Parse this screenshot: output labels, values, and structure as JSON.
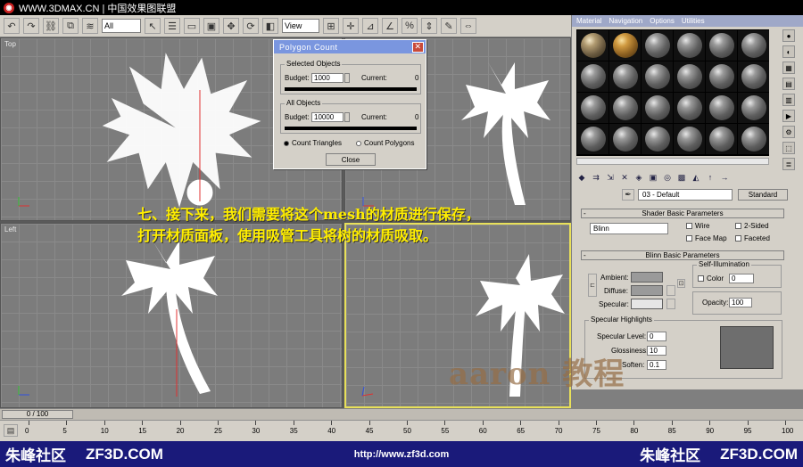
{
  "brand": {
    "text": "WWW.3DMAX.CN | 中国效果图联盟"
  },
  "toolbar": {
    "select_filter": "All",
    "ref_coord": "View"
  },
  "viewports": {
    "top_label": "Top",
    "left_label": "Left"
  },
  "polygon_dialog": {
    "title": "Polygon Count",
    "selected_group": "Selected Objects",
    "selected_budget_label": "Budget:",
    "selected_budget": "1000",
    "selected_current_label": "Current:",
    "selected_current": "0",
    "all_group": "All Objects",
    "all_budget_label": "Budget:",
    "all_budget": "10000",
    "all_current_label": "Current:",
    "all_current": "0",
    "radio_triangles": "Count Triangles",
    "radio_polygons": "Count Polygons",
    "close_label": "Close"
  },
  "material_editor": {
    "menu": [
      "Material",
      "Navigation",
      "Options",
      "Utilities"
    ],
    "material_name": "03 - Default",
    "material_type": "Standard",
    "shader_rollout": "Shader Basic Parameters",
    "shader_type": "Blinn",
    "wire": "Wire",
    "two_sided": "2-Sided",
    "face_map": "Face Map",
    "faceted": "Faceted",
    "blinn_rollout": "Blinn Basic Parameters",
    "self_illum": "Self-Illumination",
    "color_label": "Color",
    "color_value": "0",
    "ambient": "Ambient:",
    "diffuse": "Diffuse:",
    "specular": "Specular:",
    "opacity_label": "Opacity:",
    "opacity_value": "100",
    "spec_highlights": "Specular Highlights",
    "spec_level_label": "Specular Level:",
    "spec_level": "0",
    "glossiness_label": "Glossiness:",
    "glossiness": "10",
    "soften_label": "Soften:",
    "soften": "0.1"
  },
  "caption": {
    "line1": "七、接下来，我们需要将这个mesh的材质进行保存，",
    "line2": "打开材质面板，使用吸管工具将树的材质吸取。"
  },
  "watermark": "aaron 教程",
  "timeline": {
    "frame": "0 / 100",
    "ticks": [
      "0",
      "5",
      "10",
      "15",
      "20",
      "25",
      "30",
      "35",
      "40",
      "45",
      "50",
      "55",
      "60",
      "65",
      "70",
      "75",
      "80",
      "85",
      "90",
      "95",
      "100"
    ]
  },
  "footer": {
    "left_brand": "朱峰社区",
    "left_domain": "ZF3D.COM",
    "url": "http://www.zf3d.com",
    "right_brand": "朱峰社区",
    "right_domain": "ZF3D.COM"
  }
}
